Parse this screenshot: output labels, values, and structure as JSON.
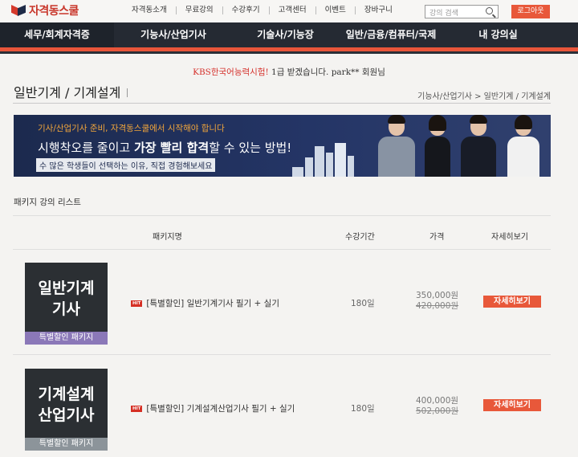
{
  "header": {
    "logo_text": "자격동스쿨",
    "nav": [
      "자격동소개",
      "무료강의",
      "수강후기",
      "고객센터",
      "이벤트",
      "장바구니"
    ],
    "search_placeholder": "강의 검색",
    "logout_label": "로그아웃"
  },
  "main_nav": [
    "세무/회계자격증",
    "기능사/산업기사",
    "기술사/기능장",
    "일반/금융/컴퓨터/국제",
    "내 강의실"
  ],
  "notice": {
    "red": "KBS한국어능력시험!",
    "rest": " 1급 받겠습니다. park** 회원님"
  },
  "page": {
    "title": "일반기계 / 기계설계",
    "breadcrumb": "기능사/산업기사 > 일반기계 / 기계설계"
  },
  "banner": {
    "line1": "기사/산업기사 준비, 자격동스쿨에서 시작해야 합니다",
    "line2_pre": "시행착오를 줄이고 ",
    "line2_bold": "가장 빨리 합격",
    "line2_post": "할 수 있는 방법!",
    "line3": "수 많은 학생들이 선택하는 이유, 직접 경험해보세요"
  },
  "package_list": {
    "title": "패키지 강의 리스트",
    "columns": [
      "패키지명",
      "수강기간",
      "가격",
      "자세히보기"
    ],
    "rows": [
      {
        "thumb_line1": "일반기계",
        "thumb_line2": "기사",
        "thumb_tag": "특별할인 패키지",
        "hot_label": "HIT",
        "name": "[특별할인] 일반기계기사 필기 + 실기",
        "period": "180일",
        "price": "350,000원",
        "old_price": "420,000원",
        "detail_label": "자세히보기"
      },
      {
        "thumb_line1": "기계설계",
        "thumb_line2": "산업기사",
        "thumb_tag": "특별할인 패키지",
        "hot_label": "HIT",
        "name": "[특별할인] 기계설계산업기사 필기 + 실기",
        "period": "180일",
        "price": "400,000원",
        "old_price": "502,000원",
        "detail_label": "자세히보기"
      }
    ]
  },
  "colors": {
    "accent": "#e8583a",
    "nav_bg": "#252a33",
    "banner_bg": "#1c2a4e",
    "tag_purple": "#8b78b8",
    "tag_gray": "#8c949a"
  }
}
